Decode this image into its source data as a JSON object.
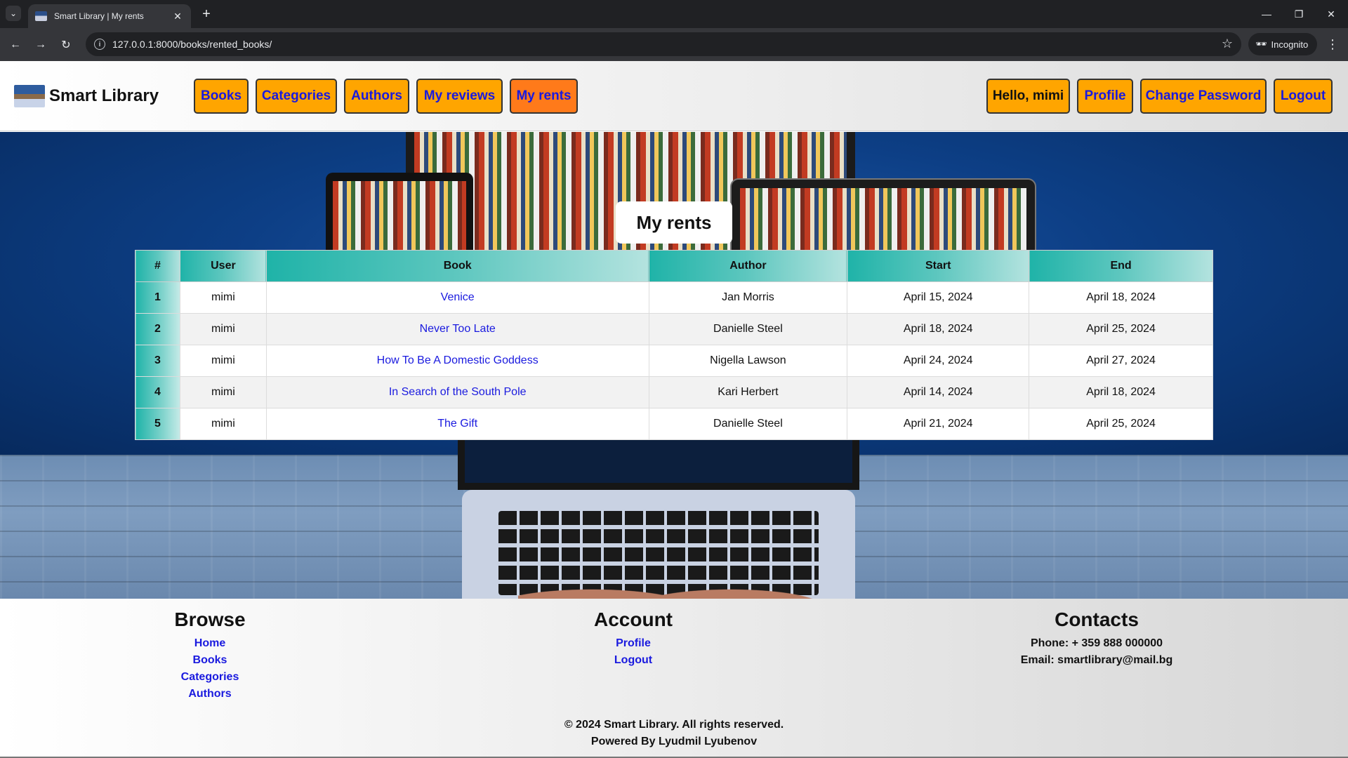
{
  "browser": {
    "tab_title": "Smart Library | My rents",
    "url": "127.0.0.1:8000/books/rented_books/",
    "incognito_label": "Incognito"
  },
  "site": {
    "logo_text": "Smart Library",
    "nav": {
      "books": "Books",
      "categories": "Categories",
      "authors": "Authors",
      "my_reviews": "My reviews",
      "my_rents": "My rents"
    },
    "user_nav": {
      "hello": "Hello, mimi",
      "profile": "Profile",
      "change_password": "Change Password",
      "logout": "Logout"
    }
  },
  "main": {
    "heading": "My rents",
    "table": {
      "headers": {
        "num": "#",
        "user": "User",
        "book": "Book",
        "author": "Author",
        "start": "Start",
        "end": "End"
      },
      "rows": [
        {
          "num": "1",
          "user": "mimi",
          "book": "Venice",
          "author": "Jan Morris",
          "start": "April 15, 2024",
          "end": "April 18, 2024"
        },
        {
          "num": "2",
          "user": "mimi",
          "book": "Never Too Late",
          "author": "Danielle Steel",
          "start": "April 18, 2024",
          "end": "April 25, 2024"
        },
        {
          "num": "3",
          "user": "mimi",
          "book": "How To Be A Domestic Goddess",
          "author": "Nigella Lawson",
          "start": "April 24, 2024",
          "end": "April 27, 2024"
        },
        {
          "num": "4",
          "user": "mimi",
          "book": "In Search of the South Pole",
          "author": "Kari Herbert",
          "start": "April 14, 2024",
          "end": "April 18, 2024"
        },
        {
          "num": "5",
          "user": "mimi",
          "book": "The Gift",
          "author": "Danielle Steel",
          "start": "April 21, 2024",
          "end": "April 25, 2024"
        }
      ]
    }
  },
  "footer": {
    "browse": {
      "title": "Browse",
      "links": {
        "home": "Home",
        "books": "Books",
        "categories": "Categories",
        "authors": "Authors"
      }
    },
    "account": {
      "title": "Account",
      "links": {
        "profile": "Profile",
        "logout": "Logout"
      }
    },
    "contacts": {
      "title": "Contacts",
      "phone": "Phone: + 359 888 000000",
      "email": "Email: smartlibrary@mail.bg"
    },
    "copyright": "© 2024 Smart Library. All rights reserved.",
    "powered_by": "Powered By Lyudmil Lyubenov"
  },
  "colors": {
    "nav_button": "#ffa500",
    "nav_button_active": "#ff7a1a",
    "link": "#1a1adf",
    "table_header_teal": "#1fb3a8",
    "hero_blue": "#0d3f86"
  }
}
